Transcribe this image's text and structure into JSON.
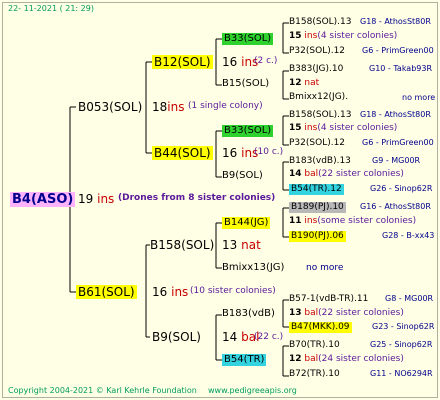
{
  "header": {
    "timestamp": "22- 11-2021 ( 21: 29)"
  },
  "footer": {
    "copyright": "Copyright 2004-2021 © Karl Kehrle Foundation",
    "site": "www.pedigreeapis.org"
  },
  "root": {
    "name": "B4(ASO)",
    "ins_num": "19",
    "ins": "ins",
    "note": "(Drones from 8 sister colonies)"
  },
  "l1": [
    {
      "name": "B053(SOL)",
      "num": "18",
      "ins": "ins",
      "note": "(1 single colony)"
    },
    {
      "name": "B61(SOL)",
      "num": "16",
      "ins": "ins",
      "note": "(10 sister colonies)"
    }
  ],
  "l2": [
    {
      "name": "B12(SOL)",
      "num": "16",
      "ins": "ins",
      "note": "(2 c.)"
    },
    {
      "name": "B44(SOL)",
      "num": "16",
      "ins": "ins",
      "note": "(10 c.)"
    },
    {
      "name": "B158(SOL)",
      "num": "13",
      "ins": "nat",
      "note": ""
    },
    {
      "name": "B9(SOL)",
      "num": "14",
      "ins": "bal",
      "note": "(22 c.)"
    }
  ],
  "l3": [
    {
      "name": "B33(SOL)"
    },
    {
      "name": "B15(SOL)"
    },
    {
      "name": "B33(SOL)"
    },
    {
      "name": "B9(SOL)"
    },
    {
      "name": "B144(JG)"
    },
    {
      "name": "Bmixx13(JG)",
      "more": "no more"
    },
    {
      "name": "B183(vdB)"
    },
    {
      "name": "B54(TR)"
    }
  ],
  "l4": [
    {
      "name": "B158(SOL).13",
      "right": "G18 - AthosSt80R"
    },
    {
      "num": "15",
      "ins": "ins",
      "note": "(4 sister colonies)"
    },
    {
      "name": "P32(SOL).12",
      "right": "G6 - PrimGreen00"
    },
    {
      "name": "B383(JG).10",
      "right": "G10 - Takab93R"
    },
    {
      "num": "12",
      "ins": "nat",
      "note": ""
    },
    {
      "name": "Bmixx12(JG).",
      "right": "no more"
    },
    {
      "name": "B158(SOL).13",
      "right": "G18 - AthosSt80R"
    },
    {
      "num": "15",
      "ins": "ins",
      "note": "(4 sister colonies)"
    },
    {
      "name": "P32(SOL).12",
      "right": "G6 - PrimGreen00"
    },
    {
      "name": "B183(vdB).13",
      "right": "G9 - MG00R"
    },
    {
      "num": "14",
      "ins": "bal",
      "note": "(22 sister colonies)"
    },
    {
      "name": "B54(TR).12",
      "right": "G26 - Sinop62R"
    },
    {
      "name": "B189(PJ).10",
      "right": "G16 - AthosSt80R"
    },
    {
      "num": "11",
      "ins": "ins",
      "note": "(some sister colonies)"
    },
    {
      "name": "B190(PJ).06",
      "right": "G28 - B-xx43"
    },
    {
      "name": "B57-1(vdB-TR).11",
      "right": "G8 - MG00R"
    },
    {
      "num": "13",
      "ins": "bal",
      "note": "(22 sister colonies)"
    },
    {
      "name": "B47(MKK).09",
      "right": "G23 - Sinop62R"
    },
    {
      "name": "B70(TR).10",
      "right": "G25 - Sinop62R"
    },
    {
      "num": "12",
      "ins": "bal",
      "note": "(24 sister colonies)"
    },
    {
      "name": "B72(TR).10",
      "right": "G11 - NO6294R"
    }
  ]
}
